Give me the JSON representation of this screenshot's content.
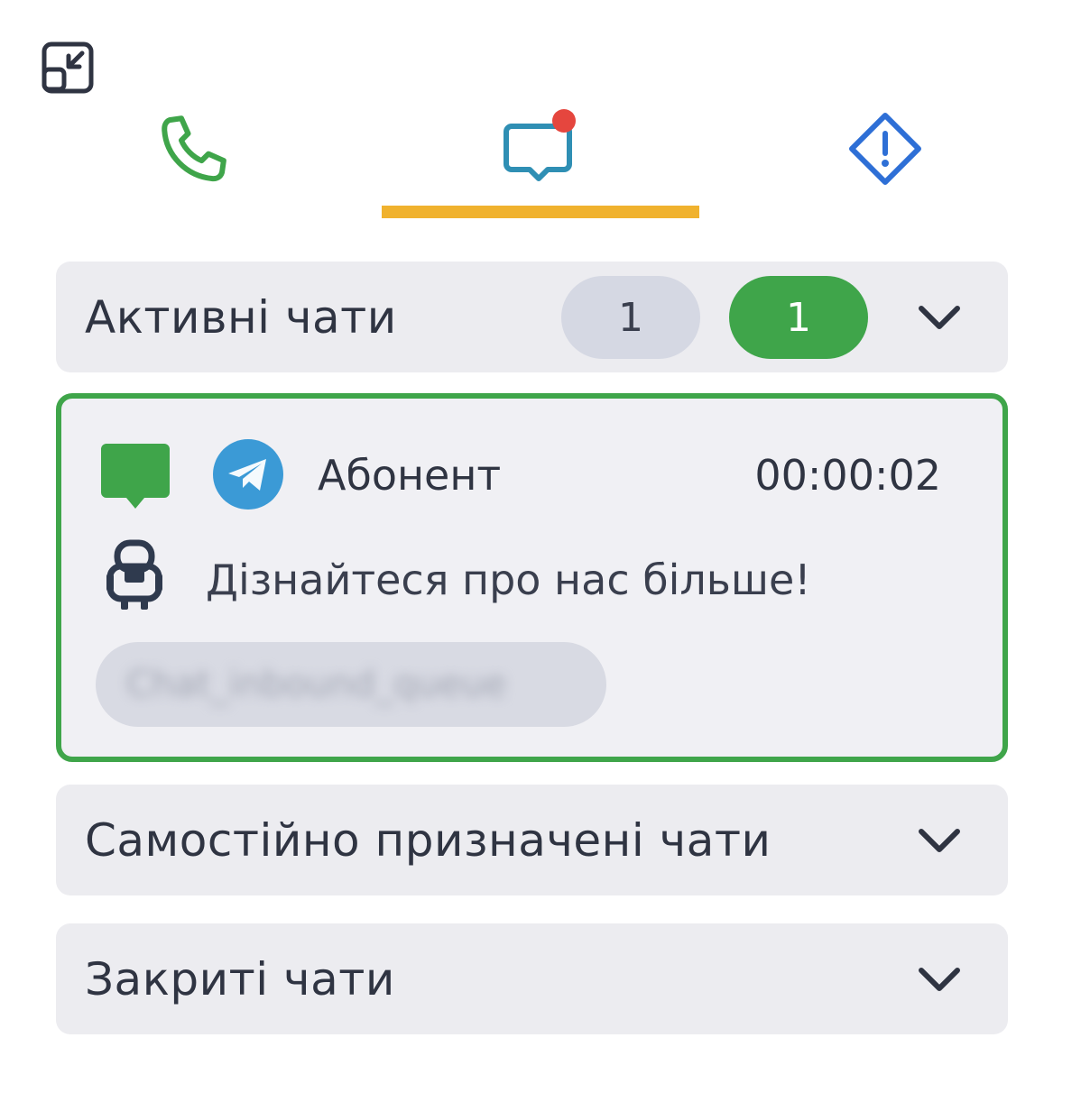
{
  "icons": {
    "collapse": "collapse-icon",
    "phone": "phone-icon",
    "chat": "chat-bubble-icon",
    "alert": "alert-diamond-icon",
    "chevron": "chevron-down-icon",
    "telegram": "telegram-icon",
    "bot": "bot-icon"
  },
  "colors": {
    "phone_tab": "#3fa54a",
    "chat_tab": "#2f8fb4",
    "notification_dot": "#e5463e",
    "alert_tab": "#2e6fd6",
    "active_underline": "#f0b22e",
    "active_green": "#3fa54a",
    "telegram": "#3b9ad6"
  },
  "sections": {
    "active": {
      "title": "Активні чати",
      "count_total": "1",
      "count_active": "1"
    },
    "self_assigned": {
      "title": "Самостійно призначені чати"
    },
    "closed": {
      "title": "Закриті чати"
    }
  },
  "chat_item": {
    "name": "Абонент",
    "timer": "00:00:02",
    "message": "Дізнайтеся про нас більше!",
    "queue": "Chat_inbound_queue"
  }
}
